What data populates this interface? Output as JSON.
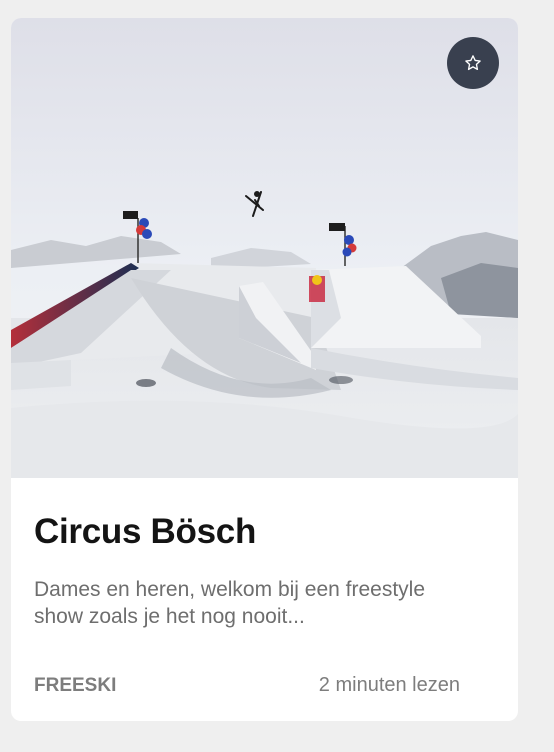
{
  "card": {
    "title": "Circus Bösch",
    "description": "Dames en heren, welkom bij een freestyle show zoals je het nog nooit...",
    "category": "FREESKI",
    "read_time": "2 minuten lezen"
  },
  "favorite_icon": "star-outline-icon",
  "colors": {
    "favorite_button_bg": "#39404f",
    "title": "#141414",
    "body_text": "#6e6e6e",
    "meta_text": "#7d7d7d",
    "page_background": "#efefef"
  }
}
